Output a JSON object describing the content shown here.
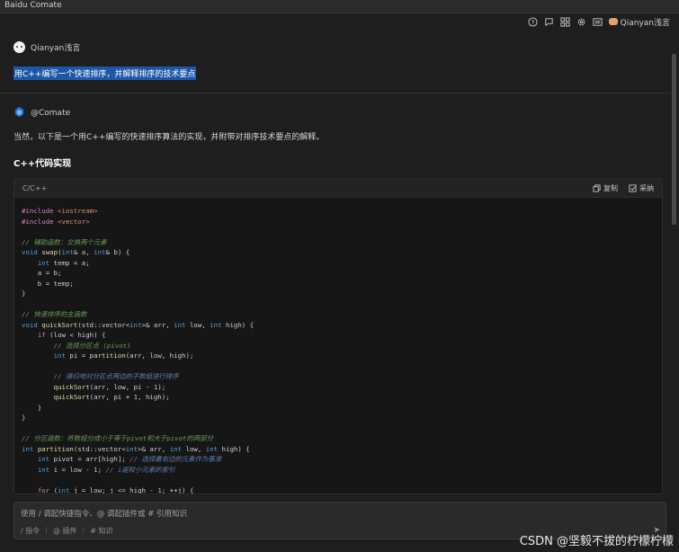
{
  "window": {
    "title": "Baidu Comate"
  },
  "toolbar": {
    "username": "Qianyan浅言"
  },
  "conversation": {
    "user_name": "Qianyan浅言",
    "user_message": "用C++编写一个快速排序，并解释排序的技术要点",
    "bot_name": "@Comate",
    "bot_intro": "当然，以下是一个用C++编写的快速排序算法的实现，并附带对排序技术要点的解释。",
    "section_title": "C++代码实现"
  },
  "code": {
    "language": "C/C++",
    "copy_label": "复制",
    "adopt_label": "采纳",
    "lines": [
      "#include <iostream>",
      "#include <vector>",
      "",
      "// 辅助函数：交换两个元素",
      "void swap(int& a, int& b) {",
      "    int temp = a;",
      "    a = b;",
      "    b = temp;",
      "}",
      "",
      "// 快速排序的主函数",
      "void quickSort(std::vector<int>& arr, int low, int high) {",
      "    if (low < high) {",
      "        // 选择分区点 (pivot)",
      "        int pi = partition(arr, low, high);",
      "",
      "        // 递归地对分区点两边的子数组进行排序",
      "        quickSort(arr, low, pi - 1);",
      "        quickSort(arr, pi + 1, high);",
      "    }",
      "}",
      "",
      "// 分区函数：将数组分成小于等于pivot和大于pivot的两部分",
      "int partition(std::vector<int>& arr, int low, int high) {",
      "    int pivot = arr[high]; // 选择最右边的元素作为基准",
      "    int i = low - 1; // i是较小元素的索引",
      "",
      "    for (int j = low; j <= high - 1; ++j) {"
    ]
  },
  "input": {
    "placeholder": "使用 / 调起快捷指令、@ 调起插件或 # 引用知识",
    "chips": [
      "/ 指令",
      "@ 插件",
      "# 知识"
    ]
  },
  "watermark": "CSDN @坚毅不拔的柠檬柠檬"
}
